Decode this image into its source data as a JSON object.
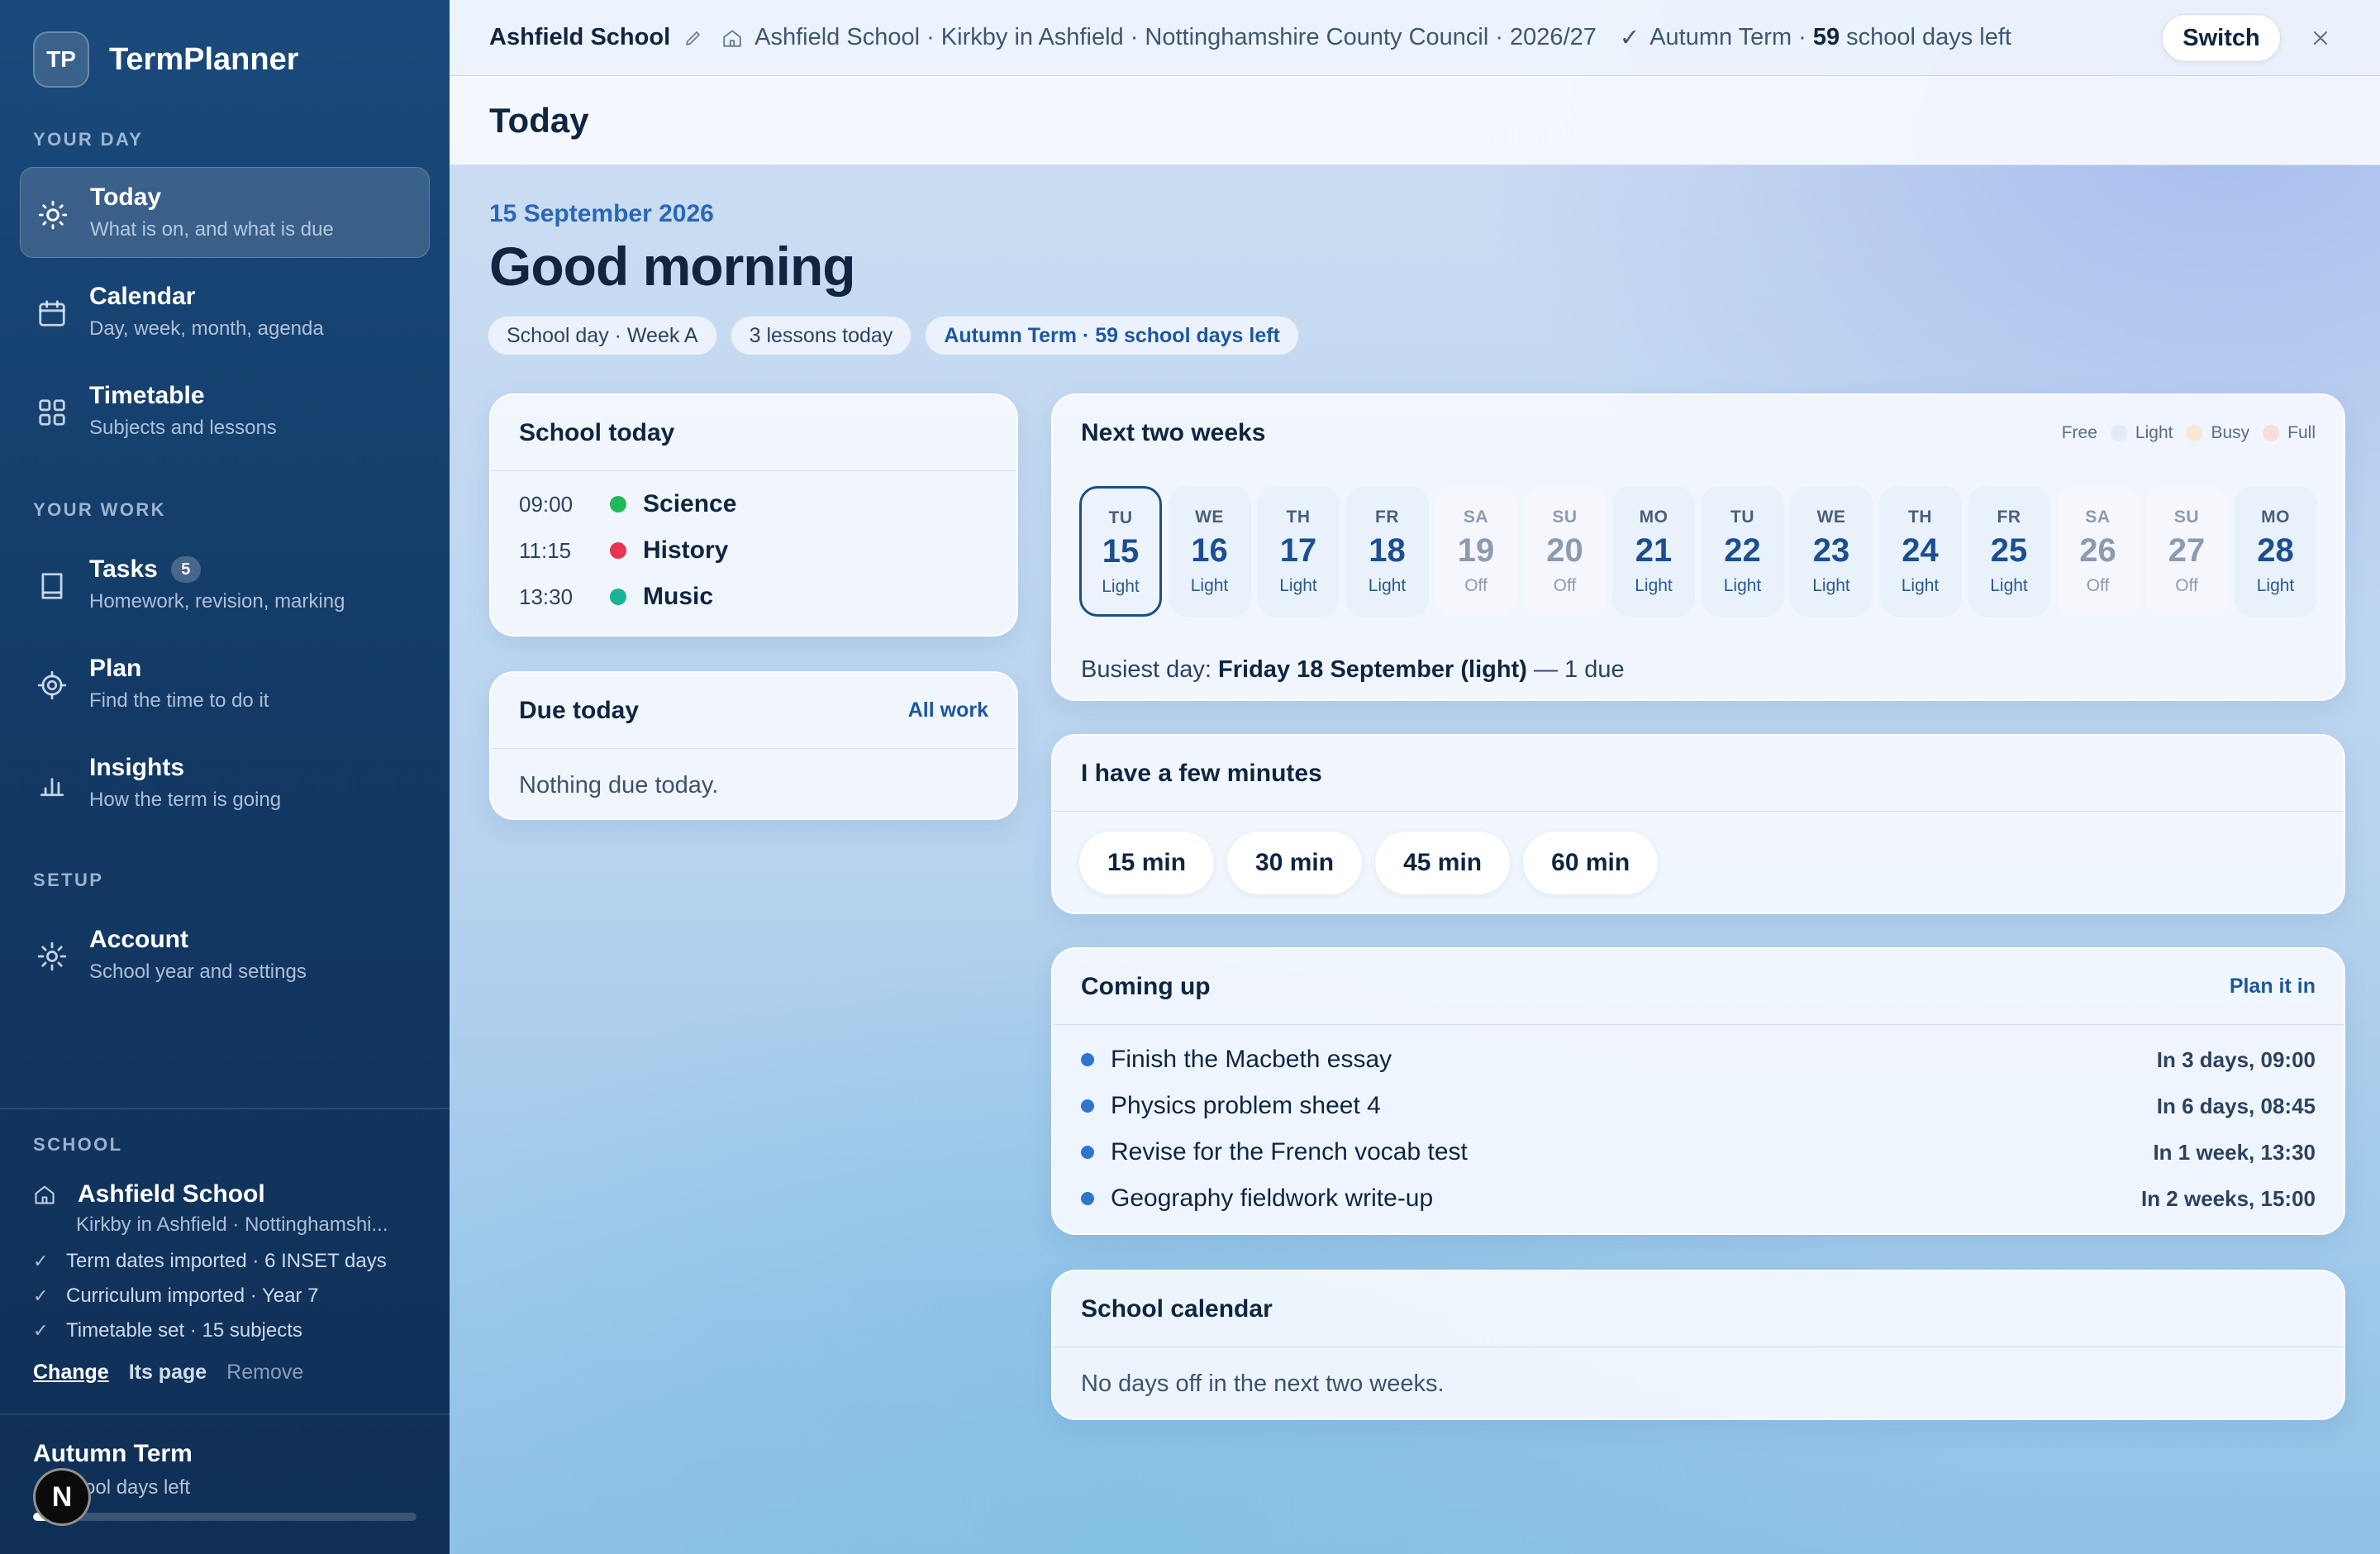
{
  "app": {
    "logo": "TP",
    "name": "TermPlanner"
  },
  "sidebar": {
    "sections": {
      "day": "YOUR DAY",
      "work": "YOUR WORK",
      "setup": "SETUP",
      "school": "SCHOOL"
    },
    "items": [
      {
        "title": "Today",
        "sub": "What is on, and what is due",
        "icon": "sun-icon"
      },
      {
        "title": "Calendar",
        "sub": "Day, week, month, agenda",
        "icon": "calendar-icon"
      },
      {
        "title": "Timetable",
        "sub": "Subjects and lessons",
        "icon": "grid-icon"
      },
      {
        "title": "Tasks",
        "sub": "Homework, revision, marking",
        "badge": "5",
        "icon": "book-icon"
      },
      {
        "title": "Plan",
        "sub": "Find the time to do it",
        "icon": "target-icon"
      },
      {
        "title": "Insights",
        "sub": "How the term is going",
        "icon": "bar-chart-icon"
      },
      {
        "title": "Account",
        "sub": "School year and settings",
        "icon": "gear-icon"
      }
    ],
    "school": {
      "name": "Ashfield School",
      "location": "Kirkby in Ashfield · Nottinghamshi...",
      "checks": [
        "Term dates imported · 6 INSET days",
        "Curriculum imported · Year 7",
        "Timetable set · 15 subjects"
      ],
      "links": {
        "change": "Change",
        "page": "Its page",
        "remove": "Remove"
      }
    },
    "term": {
      "title": "Autumn Term",
      "sub": "ool days left",
      "progress": 0.12
    },
    "avatar": "N"
  },
  "topbar": {
    "school": "Ashfield School",
    "crumb": "Ashfield School · Kirkby in Ashfield · Nottinghamshire County Council · 2026/27",
    "term_prefix": "Autumn Term ·",
    "term_days": "59",
    "term_suffix": "school days left",
    "switch": "Switch"
  },
  "page": {
    "title": "Today",
    "date": "15 September 2026",
    "greeting": "Good morning",
    "chips": [
      "School day · Week A",
      "3 lessons today",
      "Autumn Term · 59 school days left"
    ]
  },
  "school_today": {
    "title": "School today",
    "lessons": [
      {
        "time": "09:00",
        "subject": "Science",
        "color": "#22b85a"
      },
      {
        "time": "11:15",
        "subject": "History",
        "color": "#e8344e"
      },
      {
        "time": "13:30",
        "subject": "Music",
        "color": "#19b39a"
      }
    ]
  },
  "due_today": {
    "title": "Due today",
    "link": "All work",
    "empty": "Nothing due today."
  },
  "next_two_weeks": {
    "title": "Next two weeks",
    "legend": [
      {
        "label": "Free",
        "color": "#f1f4f9"
      },
      {
        "label": "Light",
        "color": "#e3ecf8"
      },
      {
        "label": "Busy",
        "color": "#fbe8d4"
      },
      {
        "label": "Full",
        "color": "#fbdcdc"
      }
    ],
    "days": [
      {
        "dow": "TU",
        "num": "15",
        "load": "Light",
        "selected": true
      },
      {
        "dow": "WE",
        "num": "16",
        "load": "Light"
      },
      {
        "dow": "TH",
        "num": "17",
        "load": "Light"
      },
      {
        "dow": "FR",
        "num": "18",
        "load": "Light"
      },
      {
        "dow": "SA",
        "num": "19",
        "load": "Off",
        "off": true
      },
      {
        "dow": "SU",
        "num": "20",
        "load": "Off",
        "off": true
      },
      {
        "dow": "MO",
        "num": "21",
        "load": "Light"
      },
      {
        "dow": "TU",
        "num": "22",
        "load": "Light"
      },
      {
        "dow": "WE",
        "num": "23",
        "load": "Light"
      },
      {
        "dow": "TH",
        "num": "24",
        "load": "Light"
      },
      {
        "dow": "FR",
        "num": "25",
        "load": "Light"
      },
      {
        "dow": "SA",
        "num": "26",
        "load": "Off",
        "off": true
      },
      {
        "dow": "SU",
        "num": "27",
        "load": "Off",
        "off": true
      },
      {
        "dow": "MO",
        "num": "28",
        "load": "Light"
      }
    ],
    "busiest_prefix": "Busiest day:",
    "busiest_day": "Friday 18 September (light)",
    "busiest_suffix": "— 1 due"
  },
  "few_minutes": {
    "title": "I have a few minutes",
    "options": [
      "15 min",
      "30 min",
      "45 min",
      "60 min"
    ]
  },
  "coming_up": {
    "title": "Coming up",
    "link": "Plan it in",
    "items": [
      {
        "title": "Finish the Macbeth essay",
        "when": "In 3 days, 09:00"
      },
      {
        "title": "Physics problem sheet 4",
        "when": "In 6 days, 08:45"
      },
      {
        "title": "Revise for the French vocab test",
        "when": "In 1 week, 13:30"
      },
      {
        "title": "Geography fieldwork write-up",
        "when": "In 2 weeks, 15:00"
      }
    ]
  },
  "school_calendar": {
    "title": "School calendar",
    "empty": "No days off in the next two weeks."
  }
}
